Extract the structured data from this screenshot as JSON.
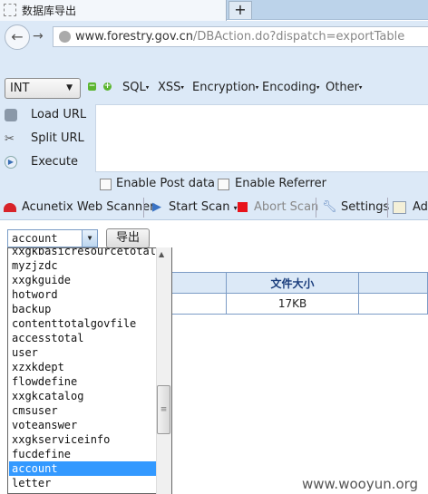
{
  "tab": {
    "title": "数据库导出",
    "new_tab": "+"
  },
  "nav": {
    "back": "←",
    "forward": "→",
    "url_host": "www.forestry.gov.cn",
    "url_path": "/DBAction.do?dispatch=exportTable"
  },
  "hackbar": {
    "type_select": "INT",
    "menus": [
      "SQL",
      "XSS",
      "Encryption",
      "Encoding",
      "Other"
    ],
    "side": [
      "Load URL",
      "Split URL",
      "Execute"
    ],
    "post_label": "Enable Post data",
    "referrer_label": "Enable Referrer",
    "textarea_value": ""
  },
  "acunetix": {
    "title": "Acunetix Web Scanner",
    "start": "Start Scan",
    "abort": "Abort Scan",
    "settings": "Settings",
    "add": "Ad",
    "brand_color": "#d8232a"
  },
  "page": {
    "selected_table": "account",
    "export_button": "导出",
    "table_header": "文件大小",
    "table_value": "17KB",
    "options": [
      "xxgkbasicresourcetotal",
      "myzjzdc",
      "xxgkguide",
      "hotword",
      "backup",
      "contenttotalgovfile",
      "accesstotal",
      "user",
      "xzxkdept",
      "flowdefine",
      "xxgkcatalog",
      "cmsuser",
      "voteanswer",
      "xxgkserviceinfo",
      "fucdefine",
      "account",
      "letter"
    ],
    "selected_index": 15
  },
  "watermark": "www.wooyun.org"
}
